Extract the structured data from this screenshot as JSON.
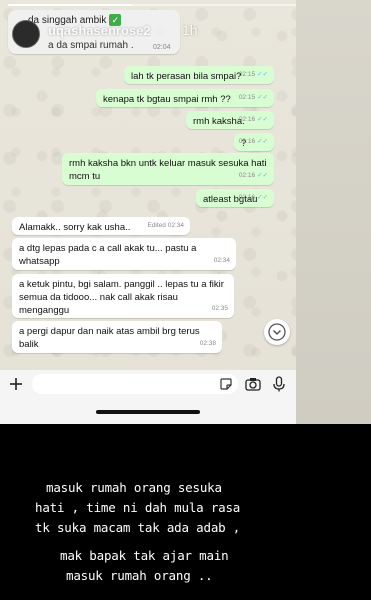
{
  "story": {
    "progress": 0.35,
    "username": "uqashasenrose2",
    "time_ago": "1h"
  },
  "header": {
    "title": "da singgah ambik",
    "quoted_text": "a da smpai rumah .",
    "quoted_time": "02:04"
  },
  "messages": [
    {
      "dir": "out",
      "text": "lah tk perasan bila smpai?",
      "time": "02:15"
    },
    {
      "dir": "out",
      "text": "kenapa tk bgtau smpai rmh ??",
      "time": "02:15"
    },
    {
      "dir": "out",
      "text": "rmh kaksha.",
      "time": "02:16"
    },
    {
      "dir": "out",
      "text": "?",
      "time": "02:16"
    },
    {
      "dir": "out",
      "text": "rmh kaksha bkn untk keluar masuk sesuka hati mcm tu",
      "time": "02:16"
    },
    {
      "dir": "out",
      "text": "atleast bgtau",
      "time": "02:16"
    },
    {
      "dir": "in",
      "text": "Alamakk.. sorry kak usha..",
      "time": "Edited 02:34"
    },
    {
      "dir": "in",
      "text": "a dtg lepas pada c a call akak tu... pastu a whatsapp",
      "time": "02:34"
    },
    {
      "dir": "in",
      "text": "a ketuk pintu, bgi salam. panggil .. lepas tu a fikir semua da tidooo... nak call akak risau menganggu",
      "time": "02:35"
    },
    {
      "dir": "in",
      "text": "a pergi dapur dan naik atas ambil brg terus balik",
      "time": "02:38"
    }
  ],
  "caption_lines": [
    "masuk rumah orang sesuka",
    "hati , time ni dah mula rasa",
    "tk suka macam tak ada adab ,",
    "mak bapak tak ajar main",
    "masuk rumah orang .."
  ],
  "colors": {
    "outgoing_bubble": "#d9fdd3",
    "incoming_bubble": "#ffffff",
    "read_ticks": "#53bdeb"
  },
  "icons": [
    "close-icon",
    "plus-icon",
    "sticker-icon",
    "camera-icon",
    "mic-icon",
    "chevron-down-icon",
    "verified-icon"
  ]
}
